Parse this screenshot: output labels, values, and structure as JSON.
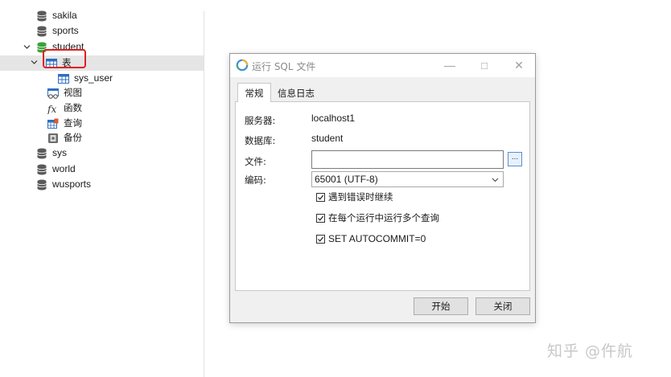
{
  "tree": {
    "items": [
      {
        "label": "sakila",
        "icon": "database-icon"
      },
      {
        "label": "sports",
        "icon": "database-icon"
      },
      {
        "label": "student",
        "icon": "database-open-icon",
        "expanded": true
      },
      {
        "label": "表",
        "icon": "table-icon",
        "expanded": true,
        "selected": true
      },
      {
        "label": "sys_user",
        "icon": "table-icon"
      },
      {
        "label": "视图",
        "icon": "view-icon"
      },
      {
        "label": "函数",
        "icon": "function-icon"
      },
      {
        "label": "查询",
        "icon": "query-icon"
      },
      {
        "label": "备份",
        "icon": "backup-icon"
      },
      {
        "label": "sys",
        "icon": "database-icon"
      },
      {
        "label": "world",
        "icon": "database-icon"
      },
      {
        "label": "wusports",
        "icon": "database-icon"
      }
    ]
  },
  "dialog": {
    "title": "运行 SQL 文件",
    "window_buttons": {
      "minimize": "—",
      "maximize": "□",
      "close": "✕"
    },
    "tabs": [
      {
        "label": "常规",
        "active": true
      },
      {
        "label": "信息日志",
        "active": false
      }
    ],
    "fields": {
      "server_label": "服务器:",
      "server_value": "localhost1",
      "database_label": "数据库:",
      "database_value": "student",
      "file_label": "文件:",
      "file_value": "",
      "browse_label": "...",
      "encoding_label": "编码:",
      "encoding_value": "65001 (UTF-8)"
    },
    "checkboxes": [
      {
        "label": "遇到错误时继续",
        "checked": true
      },
      {
        "label": "在每个运行中运行多个查询",
        "checked": true
      },
      {
        "label": "SET AUTOCOMMIT=0",
        "checked": true
      }
    ],
    "buttons": {
      "start": "开始",
      "close": "关闭"
    }
  },
  "colors": {
    "selection": "#e5e5e5",
    "highlight_box": "#e02020",
    "dialog_bg": "#f0f0f0",
    "db_icon": "#5a5a5a",
    "db_open_icon": "#3aa23a",
    "table_icon": "#2f6fc0"
  },
  "watermark": "知乎 @仵航"
}
